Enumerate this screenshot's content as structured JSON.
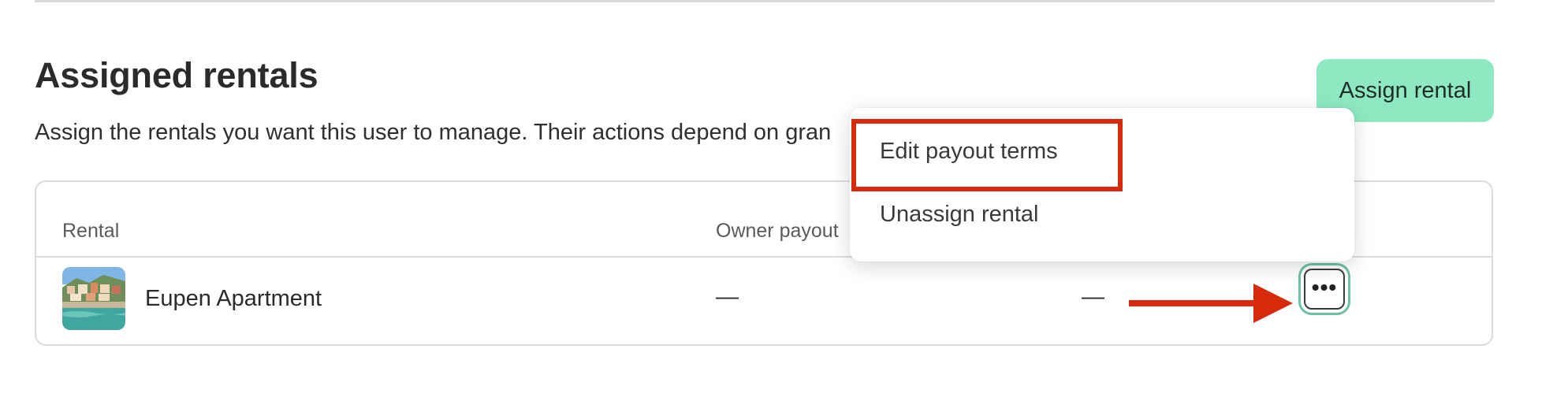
{
  "section": {
    "title": "Assigned rentals",
    "description": "Assign the rentals you want this user to manage. Their actions depend on gran",
    "assign_button_label": "Assign rental"
  },
  "table": {
    "headers": [
      "Rental",
      "Owner payout"
    ],
    "rows": [
      {
        "name": "Eupen Apartment",
        "owner_payout": "—",
        "second_value": "—"
      }
    ]
  },
  "menu": {
    "items": [
      {
        "label": "Edit payout terms"
      },
      {
        "label": "Unassign rental"
      }
    ]
  },
  "icons": {
    "more": "more-horizontal-icon",
    "thumbnail": "rental-thumbnail",
    "annotation_arrow": "arrow-right-icon"
  },
  "colors": {
    "assign_button_bg": "#8ee9c2",
    "highlight": "#d62c0d",
    "focus_ring": "#6cc2a3"
  }
}
